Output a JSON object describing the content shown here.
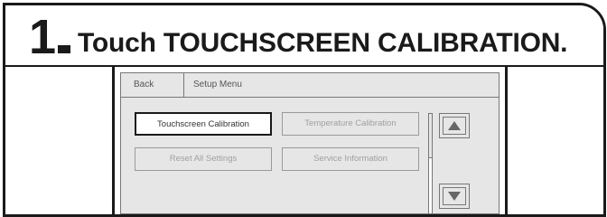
{
  "instruction": {
    "step_number": "1",
    "text": "Touch TOUCHSCREEN CALIBRATION."
  },
  "screen": {
    "back_label": "Back",
    "title": "Setup Menu",
    "buttons": [
      {
        "label": "Touchscreen Calibration",
        "state": "selected"
      },
      {
        "label": "Temperature Calibration",
        "state": "normal"
      },
      {
        "label": "Reset All Settings",
        "state": "normal"
      },
      {
        "label": "Service Information",
        "state": "normal"
      }
    ],
    "scroll_up_icon": "triangle-up-icon",
    "scroll_down_icon": "triangle-down-icon"
  },
  "colors": {
    "outline": "#1a1a1a",
    "screen_bg": "#e6e6e6",
    "button_border": "#9a9a9a",
    "button_text": "#a0a0a0",
    "arrow_fill": "#666666"
  }
}
